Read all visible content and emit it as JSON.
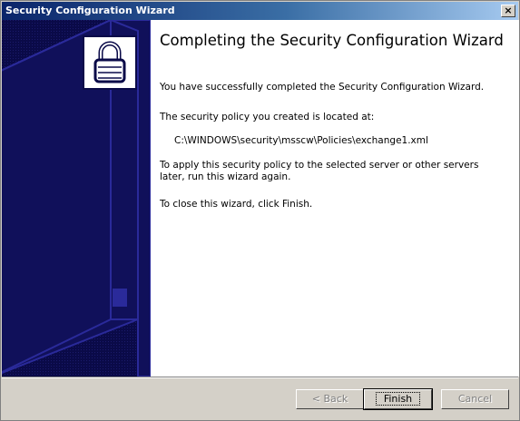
{
  "window": {
    "title": "Security Configuration Wizard",
    "close_label": "×"
  },
  "page": {
    "heading": "Completing the Security Configuration Wizard",
    "success_text": "You have successfully completed the Security Configuration Wizard.",
    "location_label": "The security policy you created is located at:",
    "policy_path": "C:\\WINDOWS\\security\\msscw\\Policies\\exchange1.xml",
    "apply_text": "To apply this security policy to the selected server or other servers later, run this wizard again.",
    "close_text": "To close this wizard, click Finish."
  },
  "buttons": {
    "back": "< Back",
    "finish": "Finish",
    "cancel": "Cancel"
  },
  "icons": {
    "sidebar_art": "server-tower-art",
    "lock": "padlock-icon"
  },
  "colors": {
    "sidebar": "#0a0a48",
    "title_start": "#0a246a",
    "title_end": "#a6caf0"
  }
}
